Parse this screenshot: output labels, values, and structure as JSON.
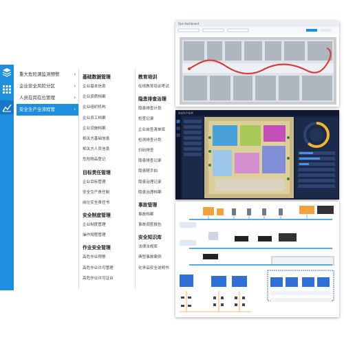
{
  "colors": {
    "accent": "#1f8fdd",
    "rail_active": "#1677c6",
    "screen_dark": "#16203a"
  },
  "rail": {
    "icons": [
      "layers-icon",
      "grid-icon",
      "chart-icon"
    ]
  },
  "level1_menu": [
    {
      "label": "重大危险源监测预警",
      "active": false
    },
    {
      "label": "企业安全风险分区",
      "active": false
    },
    {
      "label": "人员在岗在位管理",
      "active": false
    },
    {
      "label": "安全生产全流程管",
      "active": true
    }
  ],
  "menu_col2": [
    {
      "heading": "基础数据管理",
      "items": [
        "企业基本信息",
        "企业资质档案",
        "企业组织机构",
        "企业员工档案",
        "企业设施档案",
        "相关方基础信息",
        "相关方人员信息",
        "危险物品登记"
      ]
    },
    {
      "heading": "目标责任管理",
      "items": [
        "企业目标管理",
        "安全生产责任制",
        "岗位安全责任书"
      ]
    },
    {
      "heading": "安全制度管理",
      "items": [
        "企业制度管理",
        "操作规程管理"
      ]
    },
    {
      "heading": "作业安全管理",
      "items": [
        "高危作业预警",
        "高危作业许可管理",
        "高危作业许可证台"
      ]
    }
  ],
  "menu_col3": [
    {
      "heading": "教育培训",
      "items": [
        "在线教育培训考试"
      ]
    },
    {
      "heading": "隐患排查治理",
      "items": [
        "隐患排查计划",
        "检查记录",
        "企业自查清单库",
        "检测排查计划",
        "扫码排查",
        "隐患排查记录",
        "隐患随手拍",
        "隐患治理记录",
        "隐患治理档案"
      ]
    },
    {
      "heading": "事故管理",
      "items": [
        "事故档案",
        "事故调查报告"
      ]
    },
    {
      "heading": "安全知识库",
      "items": [
        "法律法规库",
        "典型事故案例",
        "化学品安全说明书"
      ]
    }
  ],
  "screen1": {
    "title": "Ops dashboard"
  },
  "screen2": {
    "title": "安全生产监测",
    "gauge_value": 0.62
  },
  "screen3": {
    "title": ""
  }
}
